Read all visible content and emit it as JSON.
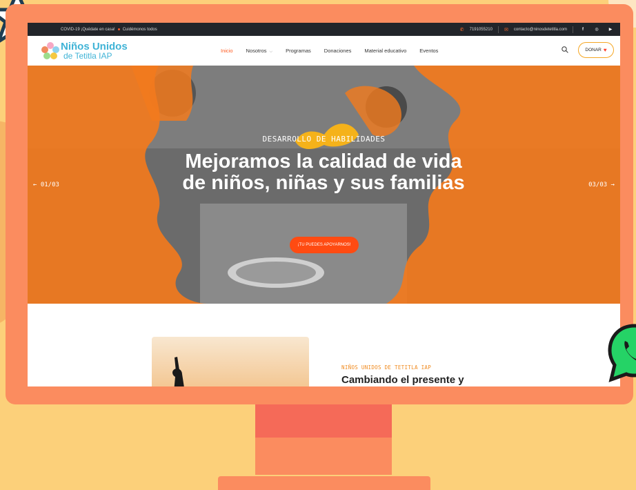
{
  "topbar": {
    "covid_text": "COVID-19 ¡Quédate en casa!",
    "care_text": "Cuidémonos todos",
    "phone": "7191055210",
    "email": "contacto@ninosdetetitla.com",
    "social": [
      "f",
      "◎",
      "▶"
    ]
  },
  "logo": {
    "line1": "Niños Unidos",
    "line2": "de Tetitla IAP"
  },
  "nav": {
    "items": [
      "Inicio",
      "Nosotros",
      "Programas",
      "Donaciones",
      "Material educativo",
      "Eventos"
    ],
    "donate_label": "DONAR"
  },
  "hero": {
    "eyebrow": "DESARROLLO DE HABILIDADES",
    "title": "Mejoramos la calidad de vida de niños, niñas y sus familias",
    "cta": "¡TU PUEDES APOYARNOS!",
    "prev": "← 01/03",
    "next": "03/03 →"
  },
  "about": {
    "eyebrow": "NIÑOS UNIDOS DE TETITLA IAP",
    "title": "Cambiando el presente y"
  },
  "colors": {
    "accent": "#ff4b12",
    "brand_blue": "#3fb3d6",
    "monitor": "#fb8c5f",
    "background": "#fcd07a"
  }
}
